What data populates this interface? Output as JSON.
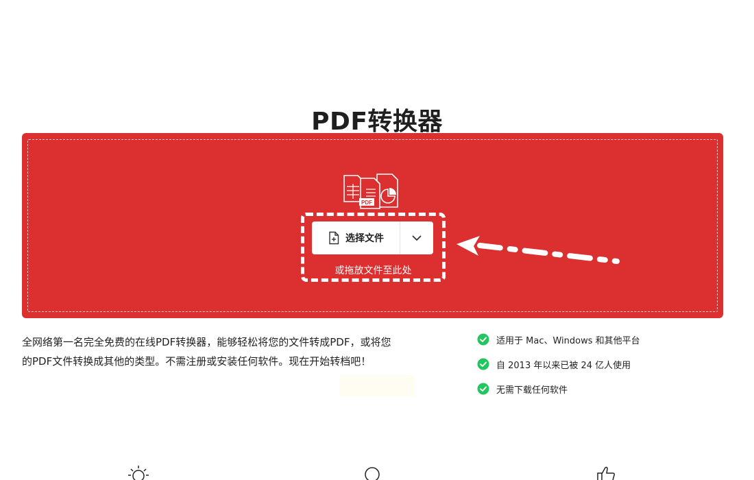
{
  "page": {
    "title": "PDF转换器"
  },
  "upload": {
    "choose_label": "选择文件",
    "drop_hint": "或拖放文件至此处",
    "file_badge": "PDF"
  },
  "description": {
    "line1": "全网络第一名完全免费的在线PDF转换器，能够轻松将您的文件转成PDF，或将您",
    "line2": "的PDF文件转换成其他的类型。不需注册或安装任何软件。现在开始转档吧！"
  },
  "features": [
    {
      "text": "适用于 Mac、Windows 和其他平台"
    },
    {
      "text": "自 2013 年以来已被 24 亿人使用"
    },
    {
      "text": "无需下载任何软件"
    }
  ],
  "colors": {
    "brand_red": "#dc2f2f",
    "check_green": "#22c55e"
  },
  "icons": {
    "file_stack": "file-stack-icon",
    "file_add": "file-add-icon",
    "dropdown": "chevron-down-icon",
    "check": "check-circle-icon",
    "bulb": "lightbulb-icon",
    "circle": "circle-icon",
    "thumb": "thumbs-up-icon"
  }
}
